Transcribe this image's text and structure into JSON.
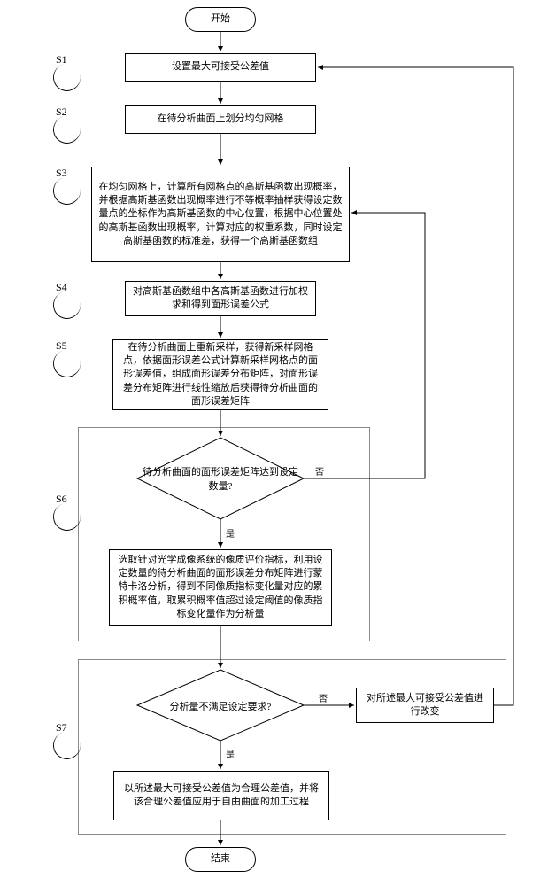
{
  "start": "开始",
  "end": "结束",
  "steps": {
    "s1": {
      "label": "S1",
      "text": "设置最大可接受公差值"
    },
    "s2": {
      "label": "S2",
      "text": "在待分析曲面上划分均匀网格"
    },
    "s3": {
      "label": "S3",
      "text": "在均匀网格上，计算所有网格点的高斯基函数出现概率，并根据高斯基函数出现概率进行不等概率抽样获得设定数量点的坐标作为高斯基函数的中心位置，根据中心位置处的高斯基函数出现概率，计算对应的权重系数，同时设定高斯基函数的标准差，获得一个高斯基函数组"
    },
    "s4": {
      "label": "S4",
      "text": "对高斯基函数组中各高斯基函数进行加权求和得到面形误差公式"
    },
    "s5": {
      "label": "S5",
      "text": "在待分析曲面上重新采样，获得新采样网格点，依据面形误差公式计算新采样网格点的面形误差值，组成面形误差分布矩阵，对面形误差分布矩阵进行线性缩放后获得待分析曲面的面形误差矩阵"
    },
    "s6": {
      "label": "S6",
      "decision": "待分析曲面的面形误差矩阵达到设定数量?",
      "process": "选取针对光学成像系统的像质评价指标，利用设定数量的待分析曲面的面形误差分布矩阵进行蒙特卡洛分析，得到不同像质指标变化量对应的累积概率值，取累积概率值超过设定阈值的像质指标变化量作为分析量"
    },
    "s7": {
      "label": "S7",
      "decision": "分析量不满足设定要求?",
      "side": "对所述最大可接受公差值进行改变",
      "process": "以所述最大可接受公差值为合理公差值，并将该合理公差值应用于自由曲面的加工过程"
    }
  },
  "labels": {
    "yes": "是",
    "no": "否"
  }
}
